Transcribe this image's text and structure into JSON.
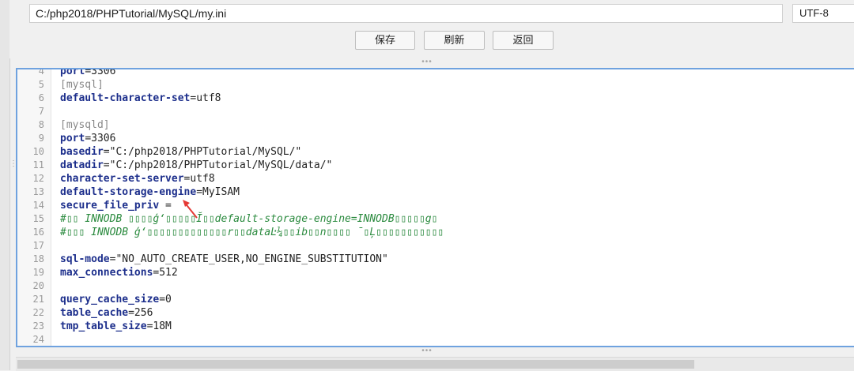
{
  "toolbar": {
    "path": "C:/php2018/PHPTutorial/MySQL/my.ini",
    "encoding": "UTF-8",
    "save_label": "保存",
    "refresh_label": "刷新",
    "back_label": "返回"
  },
  "editor": {
    "lines": [
      {
        "n": "4",
        "k": "port",
        "v": "=3306",
        "type": "kv"
      },
      {
        "n": "5",
        "t": "[mysql]",
        "type": "section"
      },
      {
        "n": "6",
        "k": "default-character-set",
        "v": "=utf8",
        "type": "kv"
      },
      {
        "n": "7",
        "t": "",
        "type": "blank"
      },
      {
        "n": "8",
        "t": "[mysqld]",
        "type": "section"
      },
      {
        "n": "9",
        "k": "port",
        "v": "=3306",
        "type": "kv"
      },
      {
        "n": "10",
        "k": "basedir",
        "v": "=\"C:/php2018/PHPTutorial/MySQL/\"",
        "type": "kv"
      },
      {
        "n": "11",
        "k": "datadir",
        "v": "=\"C:/php2018/PHPTutorial/MySQL/data/\"",
        "type": "kv"
      },
      {
        "n": "12",
        "k": "character-set-server",
        "v": "=utf8",
        "type": "kv"
      },
      {
        "n": "13",
        "k": "default-storage-engine",
        "v": "=MyISAM",
        "type": "kv"
      },
      {
        "n": "14",
        "k": "secure_file_priv",
        "v": " =",
        "type": "kv"
      },
      {
        "n": "15",
        "t": "#▯▯ INNODB ▯▯▯▯ģ‘▯▯▯▯▯Ĭ▯▯default-storage-engine=INNODB▯▯▯▯▯g▯",
        "type": "comment"
      },
      {
        "n": "16",
        "t": "#▯▯▯ INNODB ģ‘▯▯▯▯▯▯▯▯▯▯▯▯▯r▯▯dataĿ¼▯▯ib▯▯ո▯▯▯▯ ̄▯Ļ▯▯▯▯▯▯▯▯▯▯▯",
        "type": "comment"
      },
      {
        "n": "17",
        "t": "",
        "type": "blank"
      },
      {
        "n": "18",
        "k": "sql-mode",
        "v": "=\"NO_AUTO_CREATE_USER,NO_ENGINE_SUBSTITUTION\"",
        "type": "kv"
      },
      {
        "n": "19",
        "k": "max_connections",
        "v": "=512",
        "type": "kv"
      },
      {
        "n": "20",
        "t": "",
        "type": "blank"
      },
      {
        "n": "21",
        "k": "query_cache_size",
        "v": "=0",
        "type": "kv"
      },
      {
        "n": "22",
        "k": "table_cache",
        "v": "=256",
        "type": "kv"
      },
      {
        "n": "23",
        "k": "tmp_table_size",
        "v": "=18M",
        "type": "kv"
      },
      {
        "n": "24",
        "t": "",
        "type": "blank"
      }
    ]
  },
  "icons": {
    "splitter": "grip-dots-icon",
    "annotation": "red-arrow-icon"
  },
  "colors": {
    "editor_border": "#6fa2df",
    "key": "#1d2f8c",
    "comment": "#2a8a3e",
    "arrow": "#e53935"
  }
}
